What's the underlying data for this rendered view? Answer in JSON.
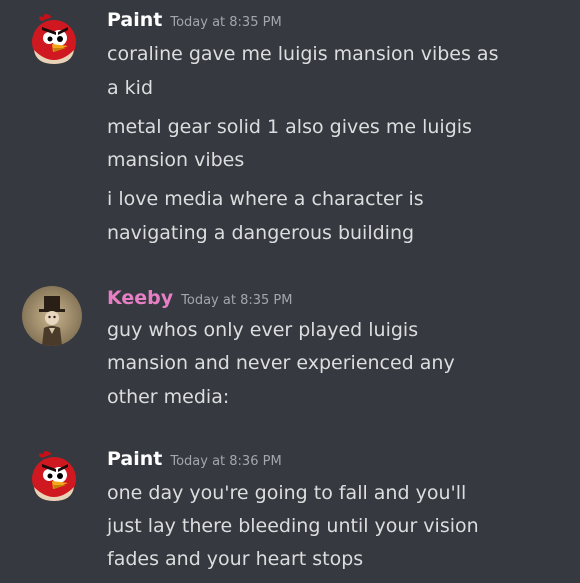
{
  "groups": [
    {
      "username": "Paint",
      "timestamp": "Today at 8:35 PM",
      "avatar": "angry-bird-icon",
      "lines": [
        "coraline gave me luigis mansion vibes as",
        "a kid",
        "metal gear solid 1 also gives me luigis",
        "mansion vibes",
        "i love media where a character is",
        "navigating a dangerous building"
      ]
    },
    {
      "username": "Keeby",
      "timestamp": "Today at 8:35 PM",
      "avatar": "top-hat-character-icon",
      "lines": [
        "guy whos only ever played luigis",
        "mansion and never experienced any",
        "other media:"
      ]
    },
    {
      "username": "Paint",
      "timestamp": "Today at 8:36 PM",
      "avatar": "angry-bird-icon",
      "lines": [
        "one day you're going to fall and you'll",
        "just lay there bleeding until your vision",
        "fades and your heart stops"
      ]
    }
  ],
  "colors": {
    "background": "#36393f",
    "username_default": "#ffffff",
    "username_keeby": "#e77fc4",
    "message_text": "#dcddde",
    "timestamp": "#a3a6aa"
  }
}
